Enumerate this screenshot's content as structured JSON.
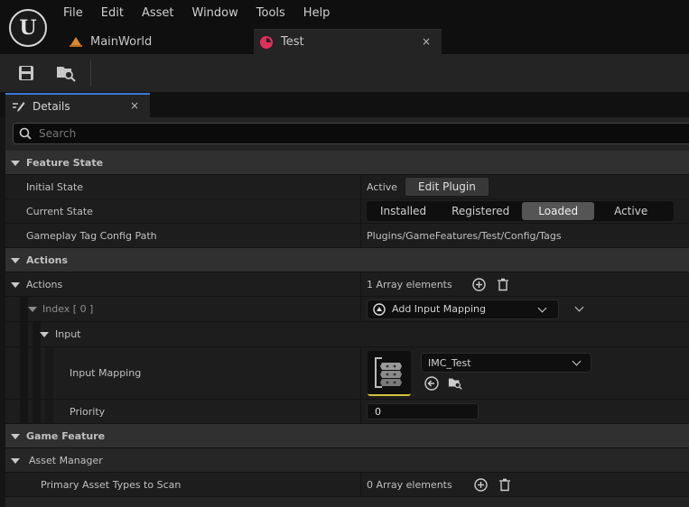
{
  "app": {
    "logo_text": "U"
  },
  "menu": [
    "File",
    "Edit",
    "Asset",
    "Window",
    "Tools",
    "Help"
  ],
  "tabs": [
    {
      "label": "MainWorld",
      "icon": "level-icon",
      "color": "#d88a2a"
    },
    {
      "label": "Test",
      "icon": "game-feature-icon",
      "color": "#e0305a",
      "close": "×"
    }
  ],
  "details": {
    "tab_label": "Details",
    "close": "×",
    "search_placeholder": "Search"
  },
  "feature_state": {
    "title": "Feature State",
    "initial_state_label": "Initial State",
    "initial_state_value": "Active",
    "edit_plugin": "Edit Plugin",
    "current_state_label": "Current State",
    "states": [
      "Installed",
      "Registered",
      "Loaded",
      "Active"
    ],
    "selected_state": "Loaded",
    "tag_path_label": "Gameplay Tag Config Path",
    "tag_path_value": "Plugins/GameFeatures/Test/Config/Tags"
  },
  "actions": {
    "category": "Actions",
    "array_label": "Actions",
    "array_count": "1 Array elements",
    "index_label": "Index [ 0 ]",
    "action_type": "Add Input Mapping",
    "input_label": "Input",
    "input_mapping_label": "Input Mapping",
    "input_mapping_value": "IMC_Test",
    "priority_label": "Priority",
    "priority_value": "0"
  },
  "game_feature": {
    "category": "Game Feature",
    "asset_manager_label": "Asset Manager",
    "primary_types_label": "Primary Asset Types to Scan",
    "primary_types_count": "0 Array elements"
  },
  "colors": {
    "accent": "#3a78d6",
    "panel": "#242424",
    "row": "#1d1d1d",
    "category": "#303030",
    "thumb_underline": "#d4c23a"
  }
}
